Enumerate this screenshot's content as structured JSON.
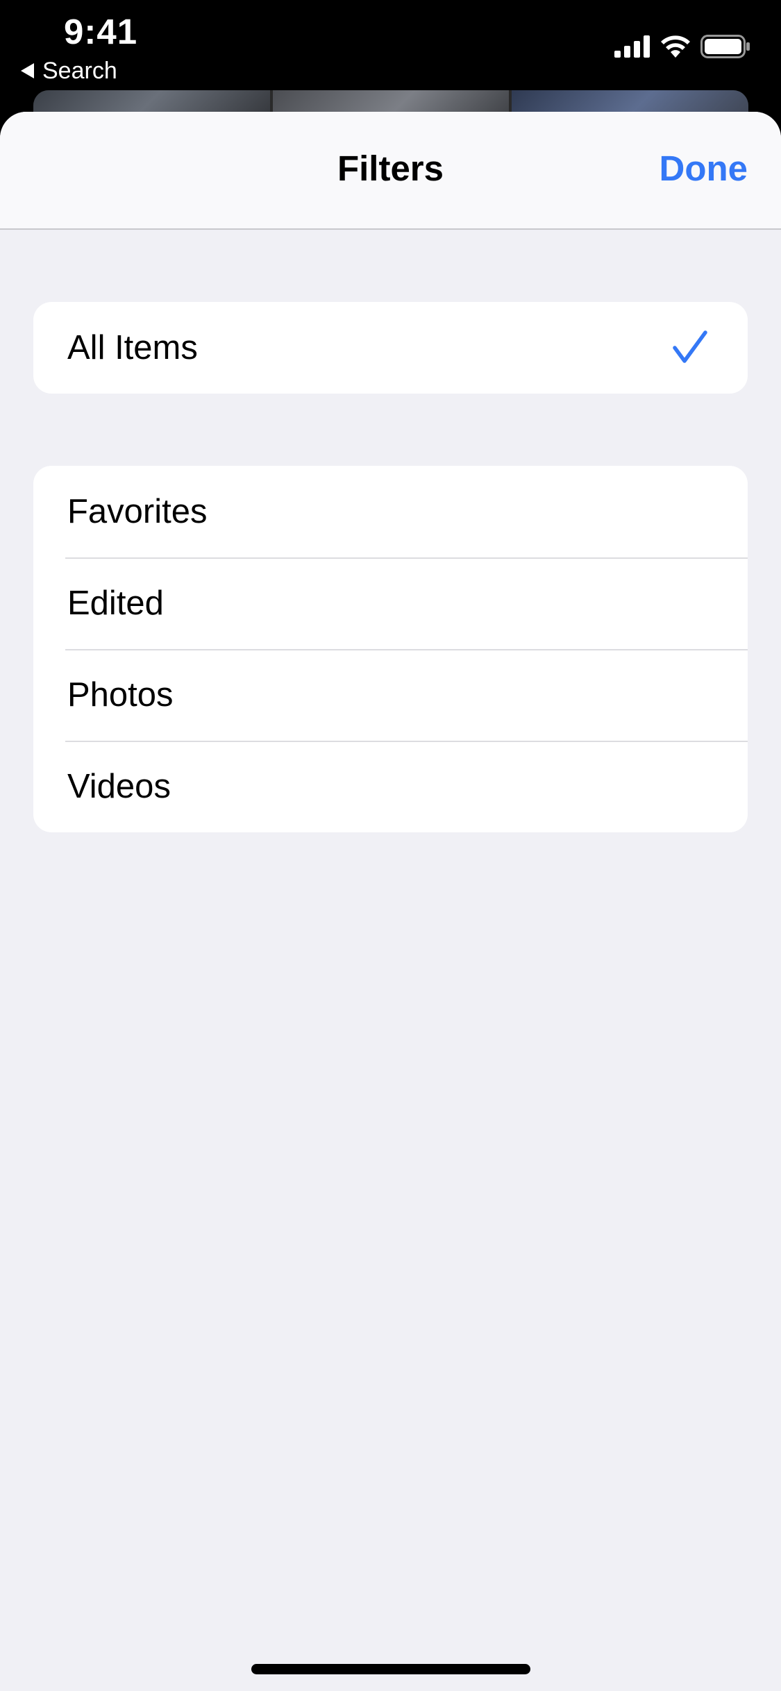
{
  "status_bar": {
    "time": "9:41",
    "back_label": "Search",
    "icons": [
      "cellular-signal-icon",
      "wifi-icon",
      "battery-icon"
    ]
  },
  "sheet": {
    "title": "Filters",
    "done_label": "Done",
    "accent_color": "#3478f6",
    "primary_group": {
      "items": [
        {
          "label": "All Items",
          "selected": true
        }
      ]
    },
    "filter_group": {
      "items": [
        {
          "label": "Favorites",
          "selected": false
        },
        {
          "label": "Edited",
          "selected": false
        },
        {
          "label": "Photos",
          "selected": false
        },
        {
          "label": "Videos",
          "selected": false
        }
      ]
    }
  }
}
